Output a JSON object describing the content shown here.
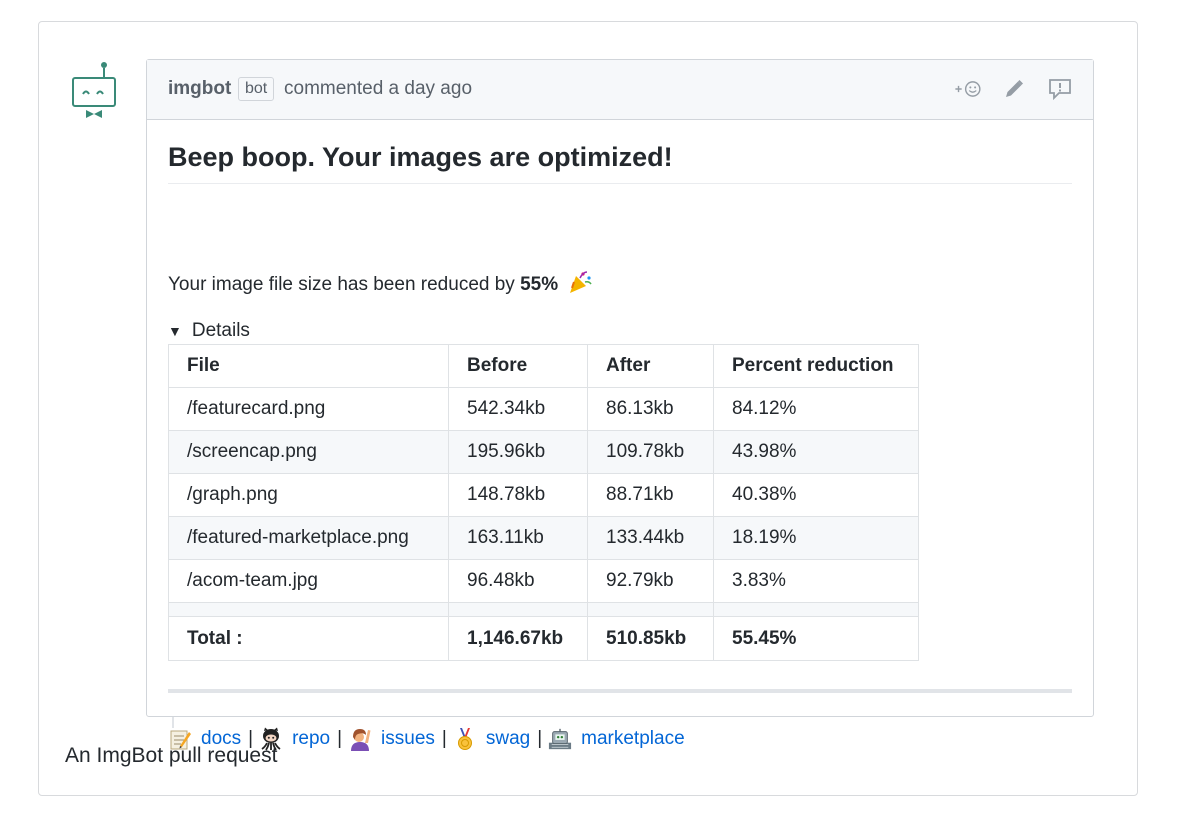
{
  "comment": {
    "author": "imgbot",
    "author_badge": "bot",
    "meta": "commented a day ago",
    "actions": [
      "add-reaction-icon",
      "pencil-icon",
      "report-icon"
    ]
  },
  "content": {
    "heading": "Beep boop. Your images are optimized!",
    "summary_prefix": "Your image file size has been reduced by",
    "summary_value": "55%",
    "details_label": "Details",
    "table": {
      "headers": [
        "File",
        "Before",
        "After",
        "Percent reduction"
      ],
      "rows": [
        [
          "/featurecard.png",
          "542.34kb",
          "86.13kb",
          "84.12%"
        ],
        [
          "/screencap.png",
          "195.96kb",
          "109.78kb",
          "43.98%"
        ],
        [
          "/graph.png",
          "148.78kb",
          "88.71kb",
          "40.38%"
        ],
        [
          "/featured-marketplace.png",
          "163.11kb",
          "133.44kb",
          "18.19%"
        ],
        [
          "/acom-team.jpg",
          "96.48kb",
          "92.79kb",
          "3.83%"
        ]
      ],
      "total": [
        "Total :",
        "1,146.67kb",
        "510.85kb",
        "55.45%"
      ]
    },
    "links": [
      {
        "icon": "memo-icon",
        "label": "docs"
      },
      {
        "icon": "octocat-icon",
        "label": "repo"
      },
      {
        "icon": "raising-hand-icon",
        "label": "issues"
      },
      {
        "icon": "medal-icon",
        "label": "swag"
      },
      {
        "icon": "robot-face-icon",
        "label": "marketplace"
      }
    ],
    "separator": "|"
  },
  "caption": "An ImgBot pull request",
  "colors": {
    "link": "#0366d6",
    "header_bg": "#f6f8fa",
    "avatar": "#3a8a78"
  }
}
